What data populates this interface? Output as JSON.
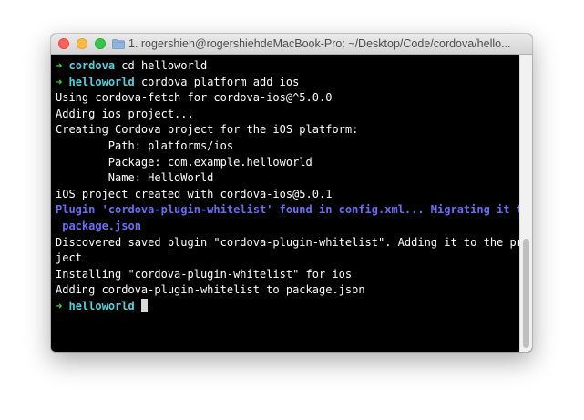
{
  "window": {
    "title": "1. rogershieh@rogershiehdeMacBook-Pro: ~/Desktop/Code/cordova/hello..."
  },
  "terminal": {
    "line_1": {
      "arrow": "➜",
      "dir": "cordova",
      "command": "cd helloworld"
    },
    "line_2": {
      "arrow": "➜",
      "dir": "helloworld",
      "command": "cordova platform add ios"
    },
    "line_3": "Using cordova-fetch for cordova-ios@^5.0.0",
    "line_4": "Adding ios project...",
    "line_5": "Creating Cordova project for the iOS platform:",
    "line_6": "        Path: platforms/ios",
    "line_7": "        Package: com.example.helloworld",
    "line_8": "        Name: HelloWorld",
    "line_9": "iOS project created with cordova-ios@5.0.1",
    "line_10": "Plugin 'cordova-plugin-whitelist' found in config.xml... Migrating it to",
    "line_11": " package.json",
    "line_12": "Discovered saved plugin \"cordova-plugin-whitelist\". Adding it to the pro",
    "line_13": "ject",
    "line_14": "Installing \"cordova-plugin-whitelist\" for ios",
    "line_15": "Adding cordova-plugin-whitelist to package.json",
    "line_16": {
      "arrow": "➜",
      "dir": "helloworld"
    }
  },
  "colors": {
    "prompt_arrow": "#35e03a",
    "prompt_dir": "#4fd4dd",
    "plugin_migration": "#6a6cf7",
    "output_text": "#ffffff",
    "background": "#000000"
  },
  "icons": {
    "window_close": "close-button",
    "window_minimize": "minimize-button",
    "window_zoom": "zoom-button",
    "title_folder": "folder-icon",
    "prompt": "prompt-arrow-icon"
  }
}
